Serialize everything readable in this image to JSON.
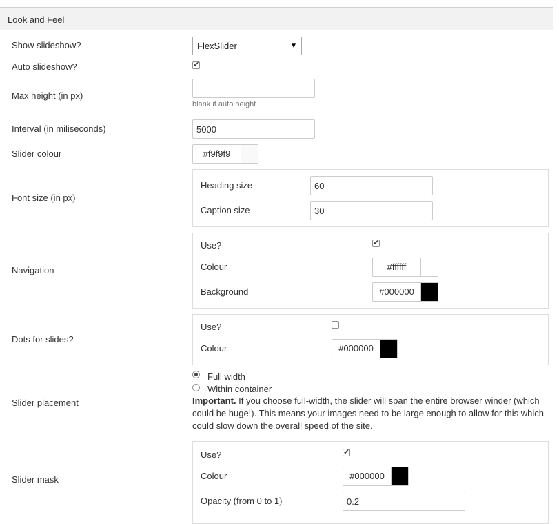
{
  "section_title": "Look and Feel",
  "show_slideshow": {
    "label": "Show slideshow?",
    "value": "FlexSlider"
  },
  "auto_slideshow": {
    "label": "Auto slideshow?",
    "checked": true
  },
  "max_height": {
    "label": "Max height (in px)",
    "value": "",
    "hint": "blank if auto height"
  },
  "interval": {
    "label": "Interval (in miliseconds)",
    "value": "5000"
  },
  "slider_colour": {
    "label": "Slider colour",
    "value": "#f9f9f9",
    "swatch": "#f9f9f9"
  },
  "font_size": {
    "label": "Font size (in px)",
    "heading_label": "Heading size",
    "heading_value": "60",
    "caption_label": "Caption size",
    "caption_value": "30"
  },
  "navigation": {
    "label": "Navigation",
    "use_label": "Use?",
    "use_checked": true,
    "colour_label": "Colour",
    "colour_value": "#ffffff",
    "colour_swatch": "#ffffff",
    "background_label": "Background",
    "background_value": "#000000",
    "background_swatch": "#000000"
  },
  "dots": {
    "label": "Dots for slides?",
    "use_label": "Use?",
    "use_checked": false,
    "colour_label": "Colour",
    "colour_value": "#000000",
    "colour_swatch": "#000000"
  },
  "placement": {
    "label": "Slider placement",
    "option_full": "Full width",
    "option_container": "Within container",
    "selected": "Full width",
    "note_bold": "Important.",
    "note_text": " If you choose full-width, the slider will span the entire browser winder (which could be huge!). This means your images need to be large enough to allow for this which could slow down the overall speed of the site."
  },
  "mask": {
    "label": "Slider mask",
    "use_label": "Use?",
    "use_checked": true,
    "colour_label": "Colour",
    "colour_value": "#000000",
    "colour_swatch": "#000000",
    "opacity_label": "Opacity (from 0 to 1)",
    "opacity_value": "0.2"
  }
}
